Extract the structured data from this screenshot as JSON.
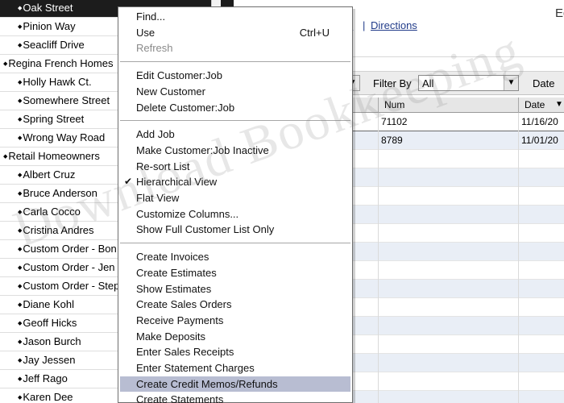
{
  "customers": [
    {
      "label": "Oak Street",
      "indent": 1,
      "selected": true
    },
    {
      "label": "Pinion Way",
      "indent": 1
    },
    {
      "label": "Seacliff Drive",
      "indent": 1
    },
    {
      "label": "Regina French Homes",
      "indent": 0
    },
    {
      "label": "Holly Hawk Ct.",
      "indent": 1
    },
    {
      "label": "Somewhere Street",
      "indent": 1
    },
    {
      "label": "Spring Street",
      "indent": 1
    },
    {
      "label": "Wrong Way Road",
      "indent": 1
    },
    {
      "label": "Retail Homeowners",
      "indent": 0
    },
    {
      "label": "Albert Cruz",
      "indent": 1
    },
    {
      "label": "Bruce Anderson",
      "indent": 1
    },
    {
      "label": "Carla Cocco",
      "indent": 1
    },
    {
      "label": "Cristina Andres",
      "indent": 1
    },
    {
      "label": "Custom Order - Bon",
      "indent": 1
    },
    {
      "label": "Custom Order - Jen",
      "indent": 1
    },
    {
      "label": "Custom Order - Step",
      "indent": 1
    },
    {
      "label": "Diane Kohl",
      "indent": 1
    },
    {
      "label": "Geoff Hicks",
      "indent": 1
    },
    {
      "label": "Jason Burch",
      "indent": 1
    },
    {
      "label": "Jay Jessen",
      "indent": 1
    },
    {
      "label": "Jeff Rago",
      "indent": 1
    },
    {
      "label": "Karen Dee",
      "indent": 1
    }
  ],
  "menu": {
    "groups": [
      [
        {
          "label": "Find...",
          "shortcut": "",
          "disabled": false
        },
        {
          "label": "Use",
          "shortcut": "Ctrl+U",
          "disabled": false
        },
        {
          "label": "Refresh",
          "shortcut": "",
          "disabled": true
        }
      ],
      [
        {
          "label": "Edit Customer:Job",
          "disabled": false
        },
        {
          "label": "New Customer",
          "disabled": false
        },
        {
          "label": "Delete Customer:Job",
          "disabled": false
        }
      ],
      [
        {
          "label": "Add Job",
          "disabled": false
        },
        {
          "label": "Make Customer:Job Inactive",
          "disabled": false
        },
        {
          "label": "Re-sort List",
          "disabled": false
        },
        {
          "label": "Hierarchical View",
          "checked": true
        },
        {
          "label": "Flat View"
        },
        {
          "label": "Customize Columns..."
        },
        {
          "label": "Show Full Customer List Only"
        }
      ],
      [
        {
          "label": "Create Invoices"
        },
        {
          "label": "Create Estimates"
        },
        {
          "label": "Show Estimates"
        },
        {
          "label": "Create Sales Orders"
        },
        {
          "label": "Receive Payments"
        },
        {
          "label": "Make Deposits"
        },
        {
          "label": "Enter Sales Receipts"
        },
        {
          "label": "Enter Statement Charges"
        },
        {
          "label": "Create Credit Memos/Refunds",
          "highlighted": true
        },
        {
          "label": "Create Statements"
        }
      ]
    ]
  },
  "header": {
    "partial_right_text": "Edit",
    "link_fragment": "e",
    "separator": "|",
    "directions_label": "Directions"
  },
  "filter": {
    "label": "Filter By",
    "value": "All",
    "date_label": "Date"
  },
  "table": {
    "col_num": "Num",
    "col_date": "Date",
    "sort_arrow": "▼",
    "rows": [
      {
        "num": "71102",
        "date": "11/16/20"
      },
      {
        "num": "8789",
        "date": "11/01/20"
      }
    ]
  },
  "watermark": "Download Bookkeeping",
  "colors": {
    "selected_row": "#1c1c1c",
    "menu_highlight": "#b8bdd2",
    "link": "#223c8a",
    "alt_row": "#e9eef6"
  }
}
